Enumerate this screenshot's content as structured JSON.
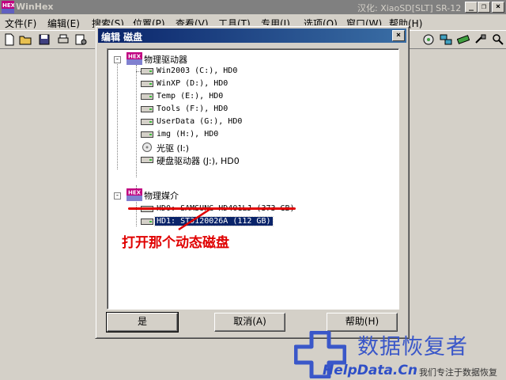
{
  "app": {
    "title": "WinHex",
    "right_title": "汉化: XiaoSD[SLT] SR-12",
    "icon_name": "winhex-logo-icon"
  },
  "window_buttons": {
    "minimize": "_",
    "restore": "❐",
    "close": "×"
  },
  "menu": [
    "文件(F)",
    "编辑(E)",
    "搜索(S)",
    "位置(P)",
    "查看(V)",
    "工具(T)",
    "专用(I)",
    "选项(O)",
    "窗口(W)",
    "帮助(H)"
  ],
  "dialog": {
    "title": "编辑 磁盘",
    "close_label": "×",
    "tree": {
      "logical_group": "物理驱动器",
      "logical_drives": [
        {
          "label": "Win2003 (C:), HD0",
          "icon": "drive-icon"
        },
        {
          "label": "WinXP (D:), HD0",
          "icon": "drive-icon"
        },
        {
          "label": "Temp (E:), HD0",
          "icon": "drive-icon"
        },
        {
          "label": "Tools (F:), HD0",
          "icon": "drive-icon"
        },
        {
          "label": "UserData (G:), HD0",
          "icon": "drive-icon"
        },
        {
          "label": "img (H:), HD0",
          "icon": "drive-icon"
        },
        {
          "label": "光驱 (I:)",
          "icon": "cdrom-icon"
        },
        {
          "label": "硬盘驱动器 (J:), HD0",
          "icon": "drive-icon"
        }
      ],
      "physical_group": "物理媒介",
      "physical_drives": [
        {
          "label": "HD0: SAMSUNG HD401LJ (373 GB)",
          "icon": "drive-icon",
          "selected": false
        },
        {
          "label": "HD1: ST3120026A (112 GB)",
          "icon": "drive-icon",
          "selected": true
        }
      ]
    },
    "annotation": "打开那个动态磁盘",
    "buttons": {
      "ok": "是",
      "cancel": "取消(A)",
      "help": "帮助(H)"
    }
  },
  "watermark": {
    "chinese": "数据恢复者",
    "url": "HelpData.Cn",
    "slogan": "我们专注于数据恢复"
  },
  "colors": {
    "title_active": "#0a246a",
    "annotation_red": "#e00000",
    "watermark_blue": "#3a57c9"
  }
}
